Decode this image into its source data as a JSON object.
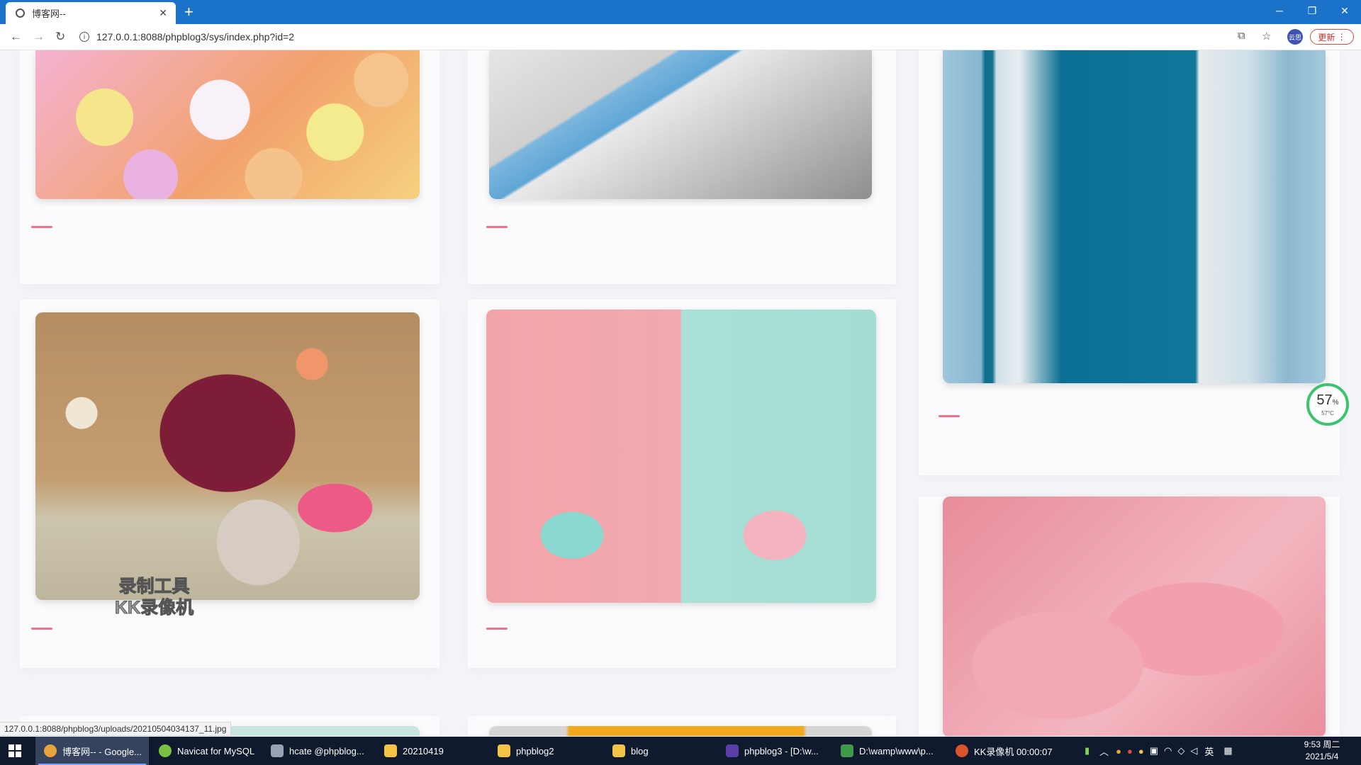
{
  "browser": {
    "tab_title": "博客网--",
    "tab_close": "✕",
    "new_tab": "+",
    "url": "127.0.0.1:8088/phpblog3/sys/index.php?id=2",
    "profile_label": "云思",
    "update_label": "更新",
    "window_controls": {
      "minimize": "─",
      "restore": "❐",
      "close": "✕"
    }
  },
  "status_url": "127.0.0.1:8088/phpblog3/uploads/20210504034137_11.jpg",
  "watermark": {
    "line1": "录制工具",
    "line2": "KK录像机"
  },
  "perf_widget": {
    "percent": "57",
    "unit": "%",
    "temperature": "57°C"
  },
  "taskbar": {
    "items": [
      {
        "label": "博客网-- - Google...",
        "color": "#e8a33b"
      },
      {
        "label": "Navicat for MySQL",
        "color": "#79c23f"
      },
      {
        "label": "hcate @phpblog...",
        "color": "#9aa3b5"
      },
      {
        "label": "20210419",
        "color": "#f3c444"
      },
      {
        "label": "phpblog2",
        "color": "#f3c444"
      },
      {
        "label": "blog",
        "color": "#f3c444"
      },
      {
        "label": "phpblog3 - [D:\\w...",
        "color": "#5c3ea8"
      },
      {
        "label": "D:\\wamp\\www\\p...",
        "color": "#3f9b4a"
      },
      {
        "label": "KK录像机 00:00:07",
        "color": "#d9542c"
      }
    ],
    "ime": "英",
    "time": "9:53 周二",
    "date": "2021/5/4"
  },
  "colors": {
    "tabbar": "#1a73c8",
    "accent_dash": "#f0728a",
    "taskbar": "#101a2e"
  }
}
